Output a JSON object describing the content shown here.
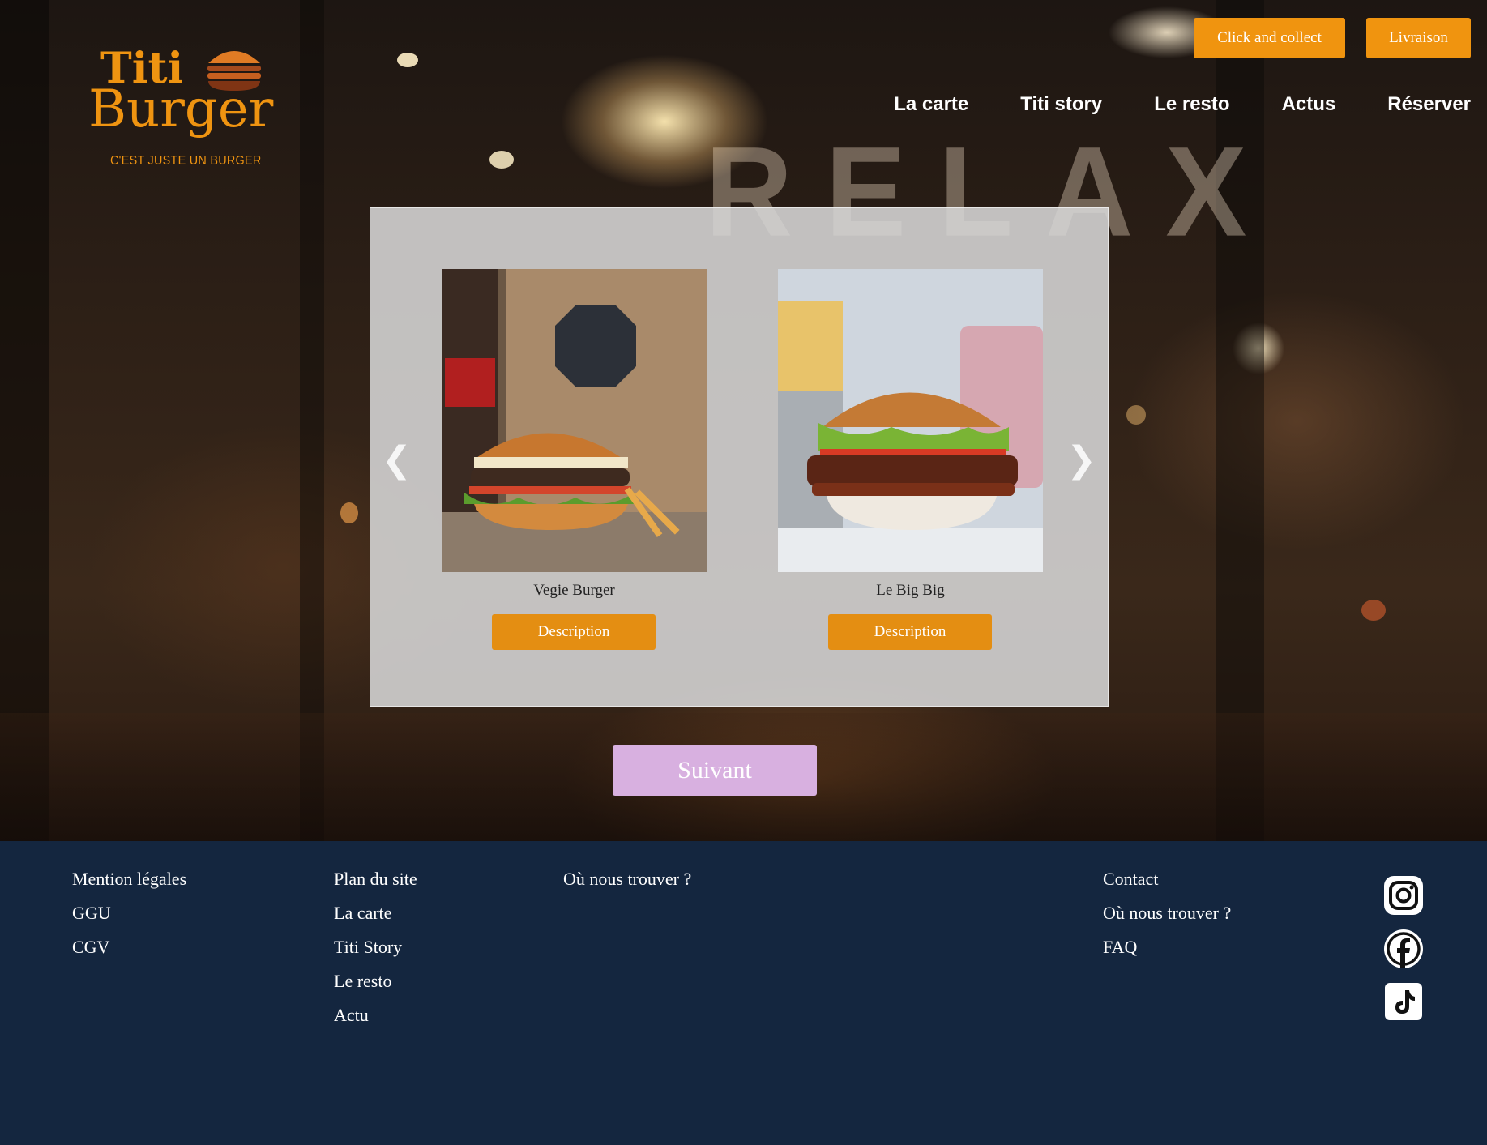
{
  "brand": {
    "name_line1": "Titi",
    "name_line2": "Burger",
    "tagline": "C'EST JUSTE UN BURGER",
    "color": "#ef9411"
  },
  "hero_text": "RELAX",
  "top_buttons": {
    "click_collect": "Click and collect",
    "delivery": "Livraison"
  },
  "nav": [
    "La carte",
    "Titi story",
    "Le resto",
    "Actus",
    "Réserver"
  ],
  "carousel": {
    "prev_arrow": "❮",
    "next_arrow": "❯",
    "items": [
      {
        "name": "Vegie Burger",
        "button": "Description"
      },
      {
        "name": "Le Big Big",
        "button": "Description"
      }
    ],
    "next_button": "Suivant"
  },
  "footer": {
    "col1": [
      "Mention légales",
      "GGU",
      "CGV"
    ],
    "col2": [
      "Plan du site",
      "La carte",
      "Titi Story",
      "Le resto",
      "Actu"
    ],
    "col3": [
      "Où nous trouver ?"
    ],
    "col4": [
      "Contact",
      "Où nous trouver ?",
      "FAQ"
    ],
    "social": [
      "instagram-icon",
      "facebook-icon",
      "tiktok-icon"
    ]
  },
  "colors": {
    "accent": "#f0940f",
    "footer_bg": "#14263f",
    "next_button": "#d8b0e0"
  }
}
